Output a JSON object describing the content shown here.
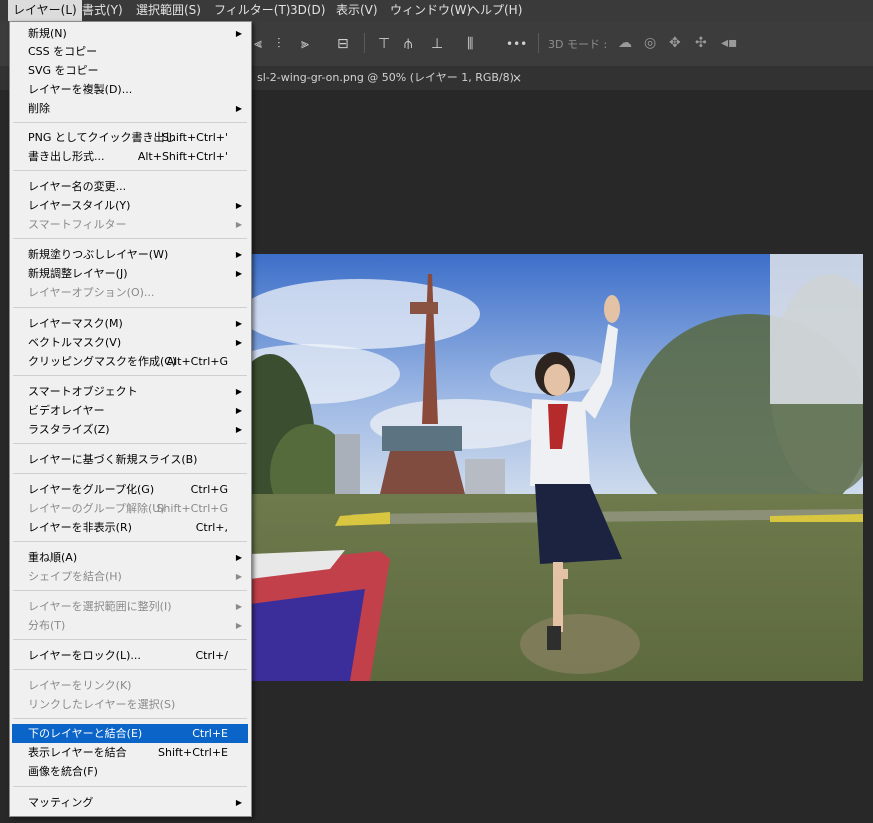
{
  "menubar": {
    "items": [
      "レイヤー(L)",
      "書式(Y)",
      "選択範囲(S)",
      "フィルター(T)",
      "3D(D)",
      "表示(V)",
      "ウィンドウ(W)",
      "ヘルプ(H)"
    ]
  },
  "options_bar": {
    "three_d_mode_label": "3D モード :",
    "more_icon": "•••"
  },
  "tab": {
    "title": "sl-2-wing-gr-on.png @ 50% (レイヤー 1, RGB/8)",
    "close": "×"
  },
  "menu": {
    "new": "新規(N)",
    "copy_css": "CSS をコピー",
    "copy_svg": "SVG をコピー",
    "duplicate_layer": "レイヤーを複製(D)...",
    "delete": "削除",
    "quick_export": "PNG としてクイック書き出し",
    "quick_export_sc": "Shift+Ctrl+'",
    "export_as": "書き出し形式...",
    "export_as_sc": "Alt+Shift+Ctrl+'",
    "rename_layer": "レイヤー名の変更...",
    "layer_style": "レイヤースタイル(Y)",
    "smart_filter": "スマートフィルター",
    "new_fill_layer": "新規塗りつぶしレイヤー(W)",
    "new_adjustment_layer": "新規調整レイヤー(J)",
    "layer_options": "レイヤーオプション(O)...",
    "layer_mask": "レイヤーマスク(M)",
    "vector_mask": "ベクトルマスク(V)",
    "create_clipping_mask": "クリッピングマスクを作成(C)",
    "create_clipping_mask_sc": "Alt+Ctrl+G",
    "smart_objects": "スマートオブジェクト",
    "video_layers": "ビデオレイヤー",
    "rasterize": "ラスタライズ(Z)",
    "new_layer_based_slice": "レイヤーに基づく新規スライス(B)",
    "group_layers": "レイヤーをグループ化(G)",
    "group_layers_sc": "Ctrl+G",
    "ungroup_layers": "レイヤーのグループ解除(U)",
    "ungroup_layers_sc": "Shift+Ctrl+G",
    "hide_layers": "レイヤーを非表示(R)",
    "hide_layers_sc": "Ctrl+,",
    "arrange": "重ね順(A)",
    "combine_shapes": "シェイプを結合(H)",
    "align_to_selection": "レイヤーを選択範囲に整列(I)",
    "distribute": "分布(T)",
    "lock_layers": "レイヤーをロック(L)...",
    "lock_layers_sc": "Ctrl+/",
    "link_layers": "レイヤーをリンク(K)",
    "select_linked": "リンクしたレイヤーを選択(S)",
    "merge_down": "下のレイヤーと結合(E)",
    "merge_down_sc": "Ctrl+E",
    "merge_visible": "表示レイヤーを結合",
    "merge_visible_sc": "Shift+Ctrl+E",
    "flatten_image": "画像を統合(F)",
    "matting": "マッティング"
  },
  "colors": {
    "menu_bg": "#f0f0f0",
    "highlight": "#0b64c8",
    "menubar_bg": "#3a3a3a",
    "workspace_bg": "#282828"
  }
}
